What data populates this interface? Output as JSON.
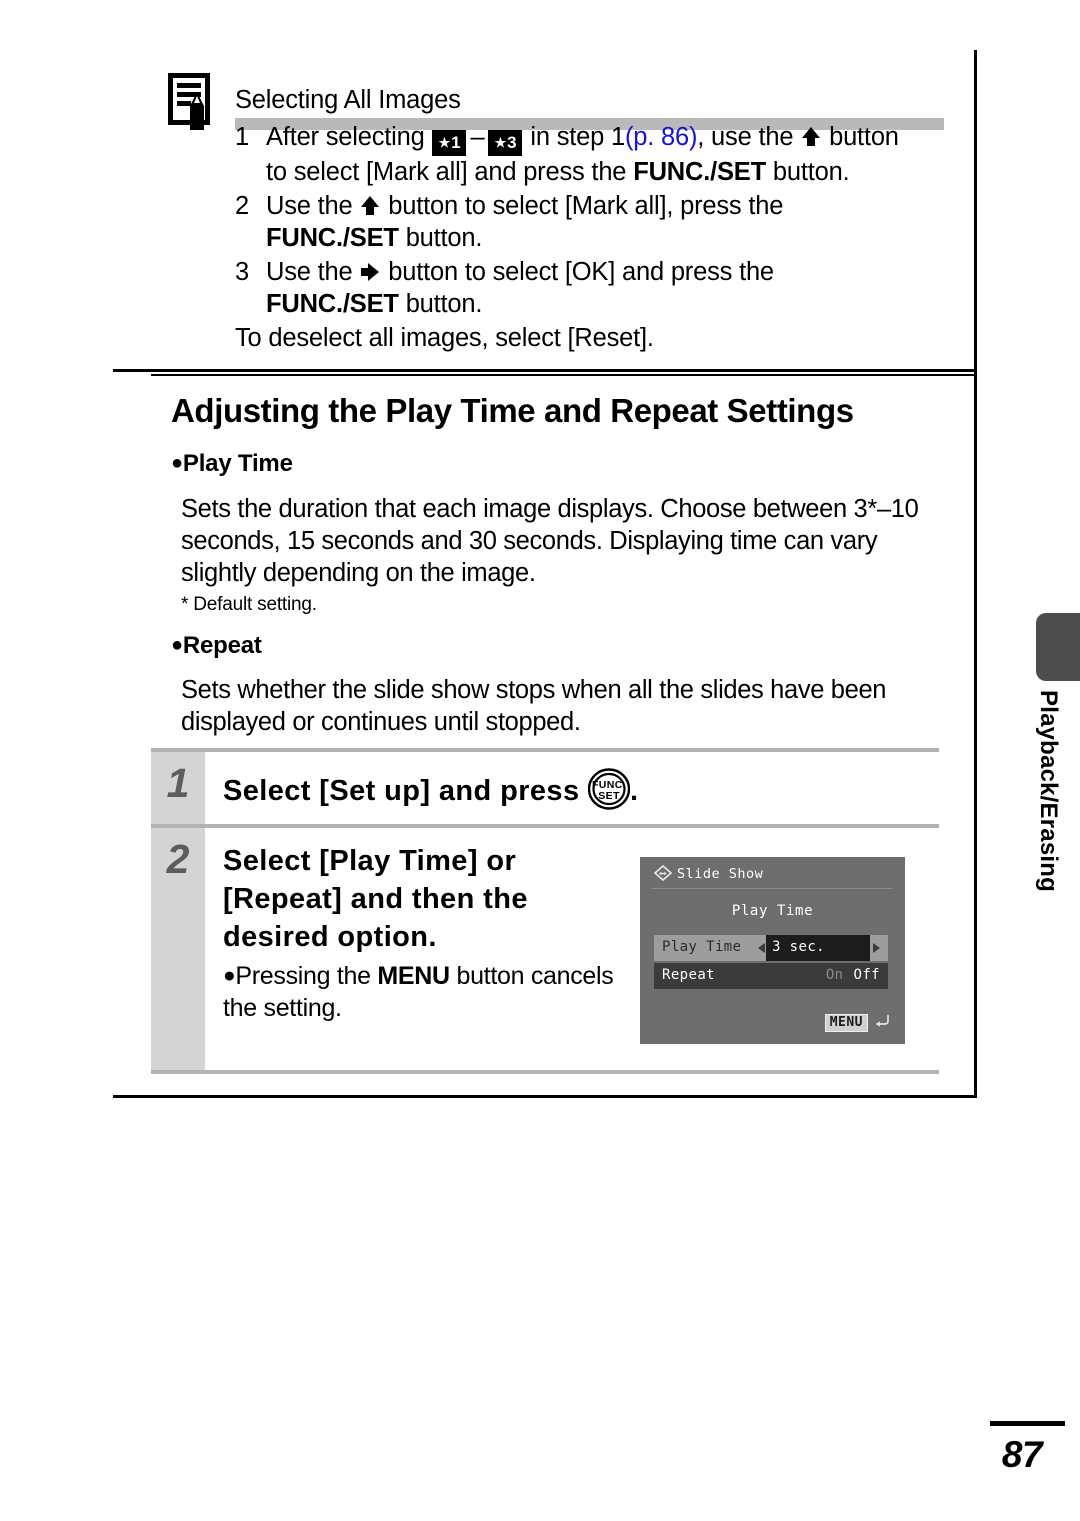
{
  "note": {
    "icon": "note-pencil-icon",
    "title": "Selecting All Images",
    "steps": [
      {
        "num": "1",
        "pre": "After selecting",
        "badge_from": "1",
        "badge_to": "3",
        "mid": "in step 1",
        "pageref": "(p. 86)",
        "post": ", use the",
        "arrow": "arrow-up-icon",
        "tail": "button to select [Mark all] and press the",
        "bold": "FUNC./SET",
        "end": "button."
      },
      {
        "num": "2",
        "pre": "Use the",
        "arrow": "arrow-up-icon",
        "tail": "button to select [Mark all], press the",
        "bold": "FUNC./SET",
        "end": "button."
      },
      {
        "num": "3",
        "pre": "Use the",
        "arrow": "arrow-right-icon",
        "tail": "button to select [OK] and press the",
        "bold": "FUNC./SET",
        "end": "button."
      }
    ],
    "closing": "To deselect all images, select [Reset]."
  },
  "section": {
    "title": "Adjusting the Play Time and Repeat Settings",
    "play_time": {
      "heading": "Play Time",
      "body": "Sets the duration that each image displays. Choose between 3*–10 seconds, 15 seconds and 30 seconds. Displaying time can vary slightly depending on the image.",
      "footnote": "* Default setting."
    },
    "repeat": {
      "heading": "Repeat",
      "body": "Sets whether the slide show stops when all the slides have been displayed or continues until stopped."
    }
  },
  "steps": [
    {
      "num": "1",
      "text_before": "Select [Set up] and press",
      "button_icon": "funcset-button-icon",
      "button_line1": "FUNC.",
      "button_line2": "SET",
      "text_after": "."
    },
    {
      "num": "2",
      "text": "Select [Play Time] or [Repeat] and then the desired option.",
      "note": "Pressing the MENU button cancels the setting.",
      "note_bold": "MENU"
    }
  ],
  "lcd": {
    "header_icon": "slide-show-icon",
    "header": "Slide Show",
    "subtitle": "Play Time",
    "rows": [
      {
        "label": "Play Time",
        "value": "3 sec.",
        "selected": true
      },
      {
        "label": "Repeat",
        "on": "On",
        "off": "Off",
        "selected": false
      }
    ],
    "menu_badge": "MENU",
    "return_icon": "return-arrow-icon"
  },
  "side_tab": {
    "label": "Playback/Erasing"
  },
  "footer": {
    "page_number": "87"
  },
  "colors": {
    "page_ref_blue": "#1414d2",
    "step_number_gray": "#5d5d5d",
    "step_col_gray": "#d4d4d4",
    "note_bar_gray": "#b9b9b9",
    "lcd_bg": "#6e6e6e",
    "lcd_selected_row": "#9d9d9d",
    "lcd_dark_row": "#3b3b3b",
    "side_tab_gray": "#4d4d4d"
  }
}
